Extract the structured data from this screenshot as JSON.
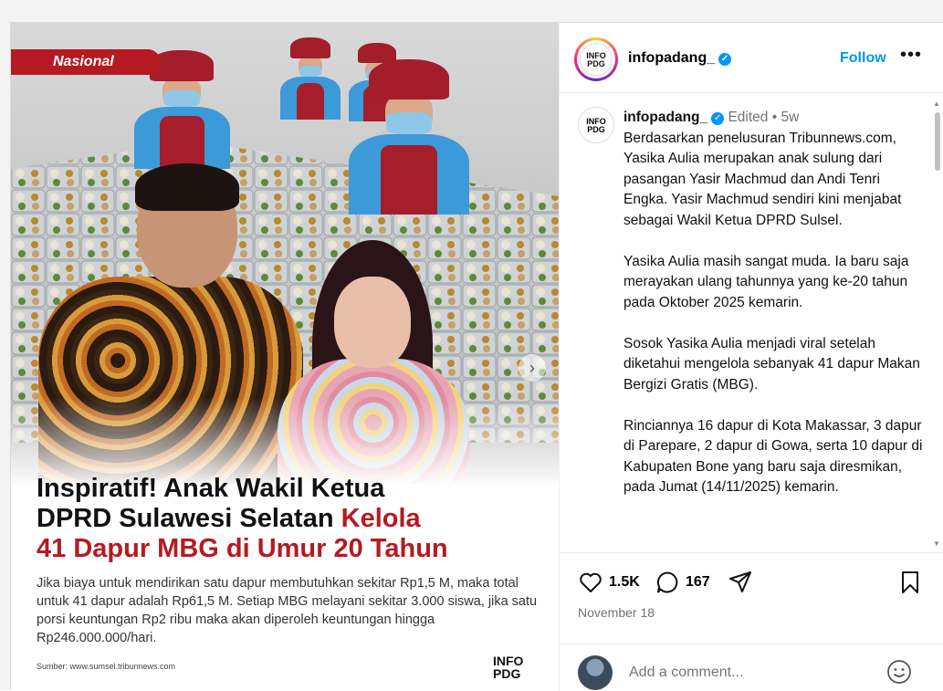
{
  "media": {
    "badge": "Nasional",
    "headline_line1": "Inspiratif! Anak Wakil Ketua",
    "headline_line2a": "DPRD Sulawesi Selatan ",
    "headline_line2b": "Kelola",
    "headline_line3": "41 Dapur MBG di Umur 20 Tahun",
    "description": "Jika biaya untuk mendirikan satu dapur membutuhkan sekitar Rp1,5 M, maka total untuk 41 dapur adalah Rp61,5 M. Setiap MBG melayani sekitar 3.000 siswa, jika satu porsi keuntungan Rp2 ribu maka akan diperoleh keuntungan hingga Rp246.000.000/hari.",
    "source": "Sumber: www.sumsel.tribunnews.com",
    "logo_top": "INFO",
    "logo_bottom": "PDG",
    "next_icon": "chevron-right-icon"
  },
  "header": {
    "username": "infopadang_",
    "follow_label": "Follow",
    "more_label": "•••",
    "avatar_top": "INFO",
    "avatar_bottom": "PDG"
  },
  "caption": {
    "username": "infopadang_",
    "edited": "Edited",
    "dot": " • ",
    "age": "5w",
    "text": "Berdasarkan penelusuran Tribunnews.com, Yasika Aulia merupakan anak sulung dari pasangan Yasir Machmud dan Andi Tenri Engka. Yasir Machmud sendiri kini menjabat sebagai Wakil Ketua DPRD Sulsel.\n\nYasika Aulia masih sangat muda. Ia baru saja merayakan ulang tahunnya yang ke-20 tahun pada Oktober 2025 kemarin.\n\nSosok Yasika Aulia menjadi viral setelah diketahui mengelola sebanyak 41 dapur Makan Bergizi Gratis (MBG).\n\nRinciannya 16 dapur di Kota Makassar, 3 dapur di Parepare, 2 dapur di Gowa, serta 10 dapur di Kabupaten Bone yang baru saja diresmikan, pada Jumat (14/11/2025) kemarin."
  },
  "actions": {
    "likes": "1.5K",
    "comments": "167",
    "date": "November 18"
  },
  "comment": {
    "placeholder": "Add a comment..."
  },
  "colors": {
    "accent": "#0095f6",
    "brand_red": "#b51a22",
    "muted": "#737373"
  }
}
